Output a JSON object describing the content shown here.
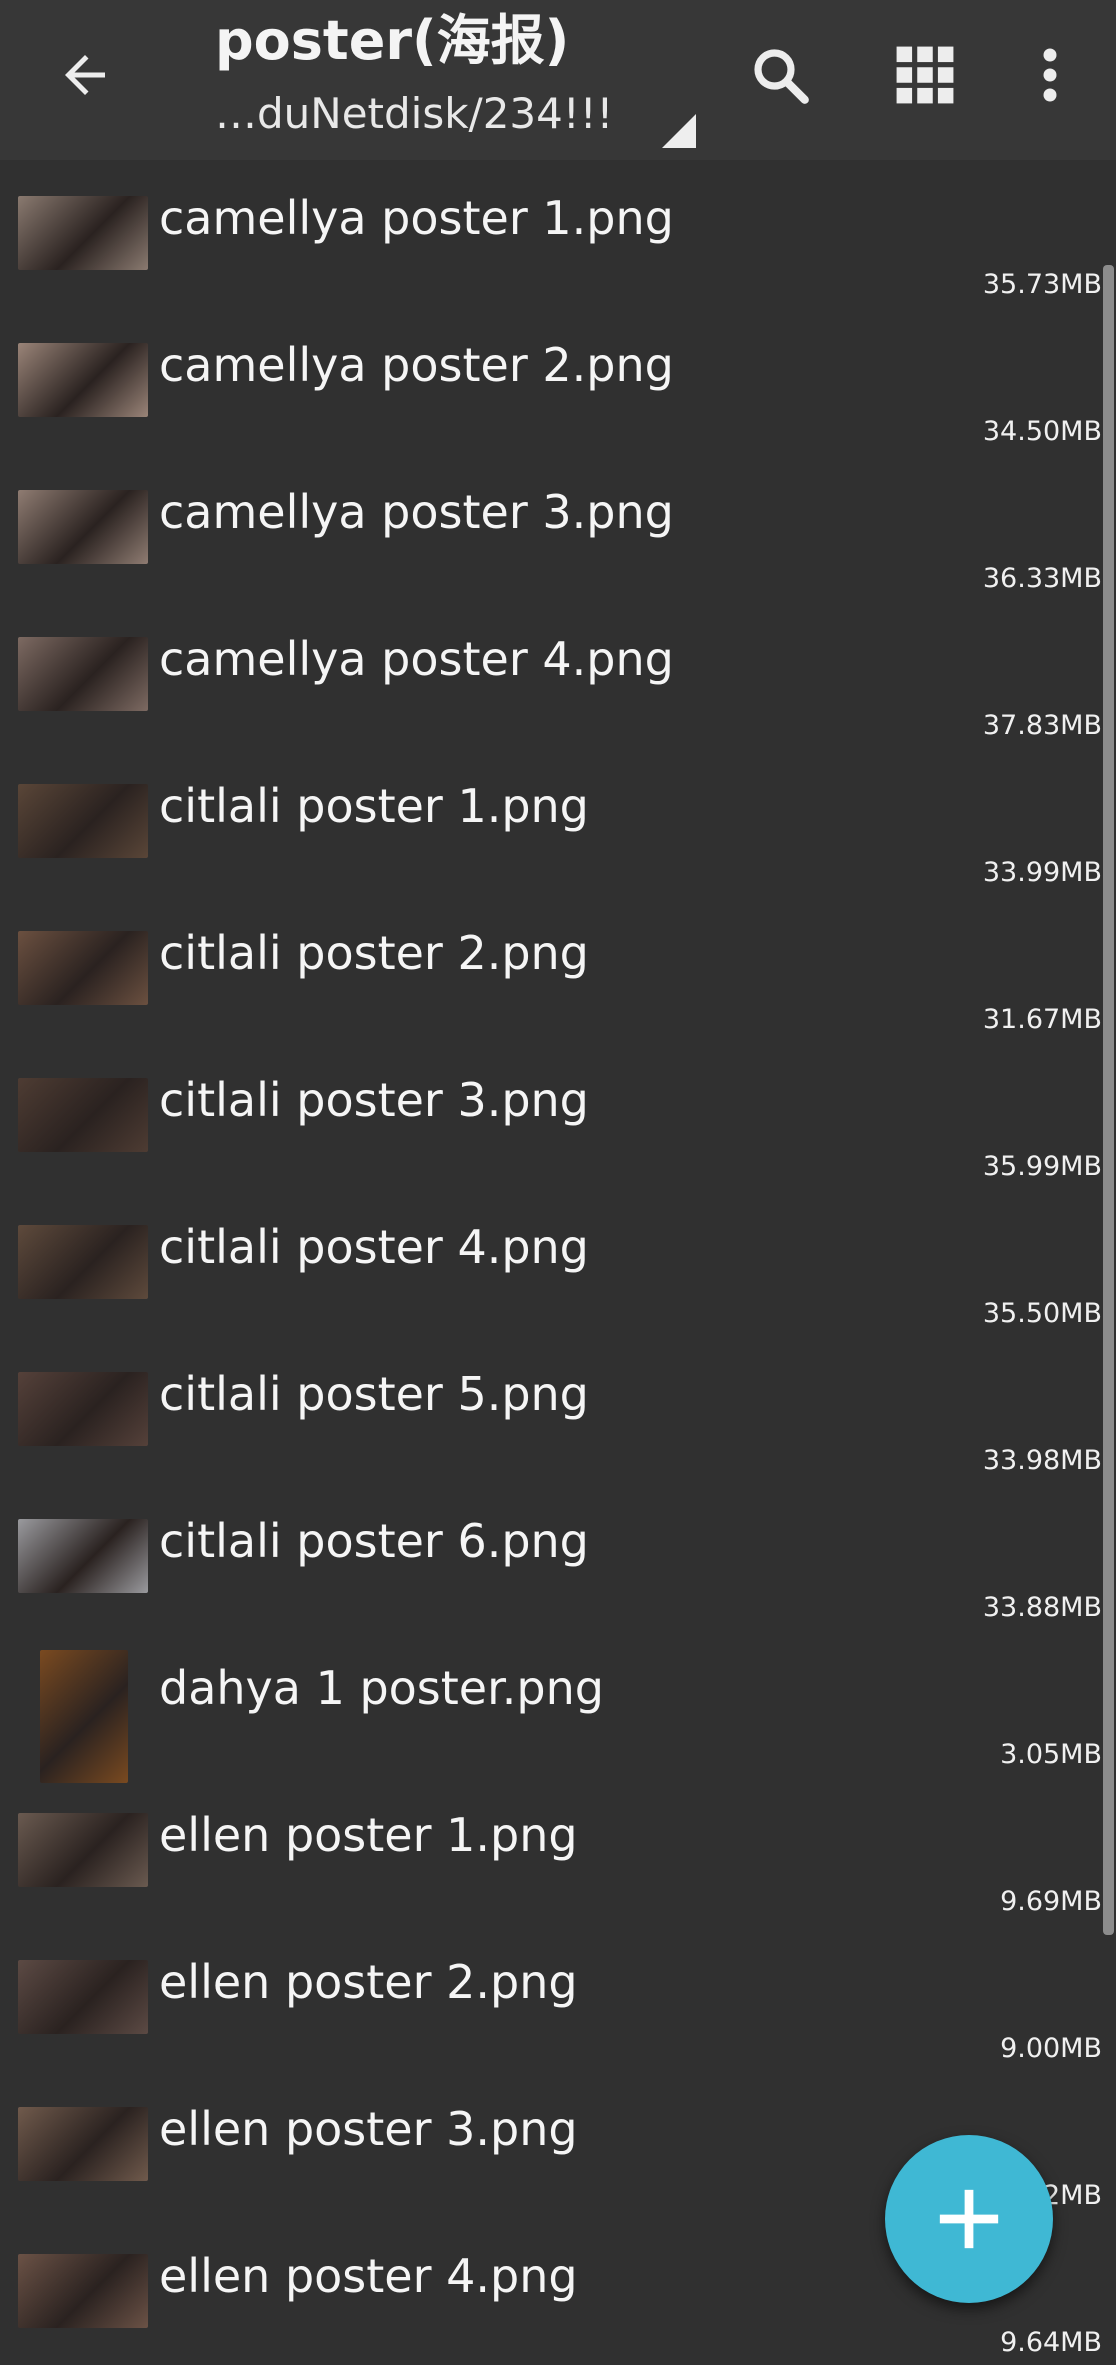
{
  "header": {
    "title": "poster(海报)",
    "path": "…duNetdisk/234!!!",
    "icons": [
      "back-arrow-icon",
      "search-icon",
      "grid-view-icon",
      "more-vert-icon"
    ]
  },
  "files": [
    {
      "name": "camellya poster 1.png",
      "size": "35.73MB",
      "thumb": "#8a7a70"
    },
    {
      "name": "camellya poster 2.png",
      "size": "34.50MB",
      "thumb": "#9a8478"
    },
    {
      "name": "camellya poster 3.png",
      "size": "36.33MB",
      "thumb": "#8f7c72"
    },
    {
      "name": "camellya poster 4.png",
      "size": "37.83MB",
      "thumb": "#7d6a62"
    },
    {
      "name": "citlali poster 1.png",
      "size": "33.99MB",
      "thumb": "#5a4638"
    },
    {
      "name": "citlali poster 2.png",
      "size": "31.67MB",
      "thumb": "#6b5040"
    },
    {
      "name": "citlali poster 3.png",
      "size": "35.99MB",
      "thumb": "#4e3c33"
    },
    {
      "name": "citlali poster 4.png",
      "size": "35.50MB",
      "thumb": "#5e4a3c"
    },
    {
      "name": "citlali poster 5.png",
      "size": "33.98MB",
      "thumb": "#55413a"
    },
    {
      "name": "citlali poster 6.png",
      "size": "33.88MB",
      "thumb": "#9a9a9e"
    },
    {
      "name": "dahya 1 poster.png",
      "size": "3.05MB",
      "thumb": "#7a4a20"
    },
    {
      "name": "ellen poster 1.png",
      "size": "9.69MB",
      "thumb": "#6a5a50"
    },
    {
      "name": "ellen poster 2.png",
      "size": "9.00MB",
      "thumb": "#5c4a44"
    },
    {
      "name": "ellen poster 3.png",
      "size": "9.72MB",
      "thumb": "#705a4c"
    },
    {
      "name": "ellen poster 4.png",
      "size": "9.64MB",
      "thumb": "#6b5246"
    }
  ],
  "fab": {
    "icon": "plus-icon",
    "color": "#3fb8d4"
  }
}
